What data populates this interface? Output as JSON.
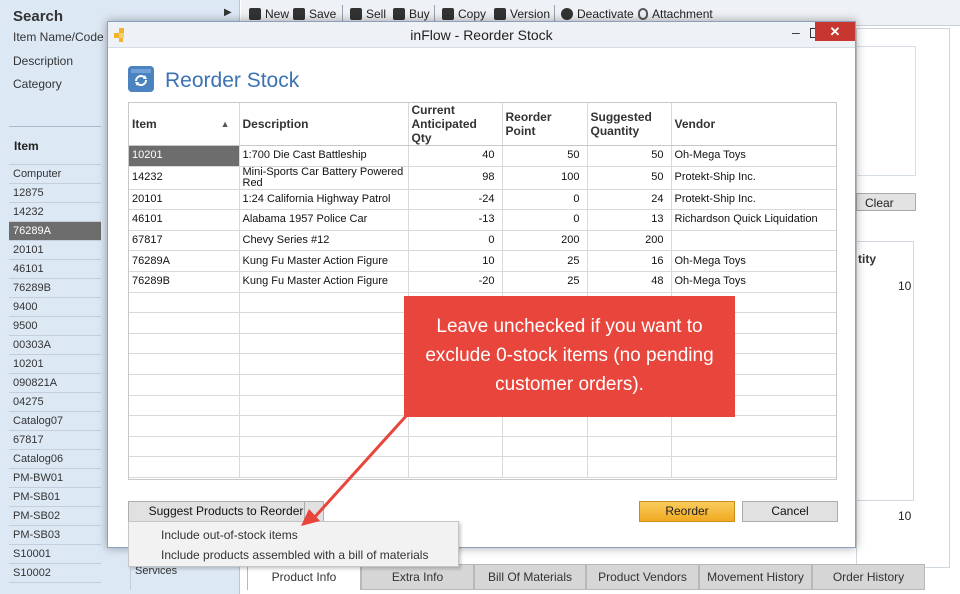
{
  "left_panel": {
    "title": "Search",
    "labels": [
      "Item Name/Code",
      "Description",
      "Category"
    ],
    "list_header": "Item",
    "items": [
      "Computer",
      "12875",
      "14232",
      "76289A",
      "20101",
      "46101",
      "76289B",
      "9400",
      "9500",
      "00303A",
      "10201",
      "090821A",
      "04275",
      "Catalog07",
      "67817",
      "Catalog06",
      "PM-BW01",
      "PM-SB01",
      "PM-SB02",
      "PM-SB03",
      "S10001",
      "S10002"
    ],
    "selected_item": "76289A",
    "services_label": "Services"
  },
  "toolbar": {
    "new": "New",
    "save": "Save",
    "sell": "Sell",
    "buy": "Buy",
    "copy": "Copy",
    "version": "Version",
    "deactivate": "Deactivate",
    "attachment": "Attachment"
  },
  "right_panel": {
    "clear_label": "Clear",
    "header_fragment": "tity",
    "value_top": "10",
    "value_bottom": "10"
  },
  "bottom_tabs": [
    "Product Info",
    "Extra Info",
    "Bill Of Materials",
    "Product Vendors",
    "Movement History",
    "Order History"
  ],
  "modal": {
    "window_title": "inFlow - Reorder Stock",
    "header_title": "Reorder Stock",
    "columns": [
      "Item",
      "Description",
      "Current Anticipated Qty",
      "Reorder Point",
      "Suggested Quantity",
      "Vendor"
    ],
    "rows": [
      {
        "item": "10201",
        "description": "1:700 Die Cast Battleship",
        "qty": "40",
        "reorder": "50",
        "suggested": "50",
        "vendor": "Oh-Mega Toys"
      },
      {
        "item": "14232",
        "description": "Mini-Sports Car Battery Powered Red",
        "qty": "98",
        "reorder": "100",
        "suggested": "50",
        "vendor": "Protekt-Ship Inc."
      },
      {
        "item": "20101",
        "description": "1:24 California Highway Patrol",
        "qty": "-24",
        "reorder": "0",
        "suggested": "24",
        "vendor": "Protekt-Ship Inc."
      },
      {
        "item": "46101",
        "description": "Alabama 1957 Police Car",
        "qty": "-13",
        "reorder": "0",
        "suggested": "13",
        "vendor": "Richardson Quick Liquidation"
      },
      {
        "item": "67817",
        "description": "Chevy Series #12",
        "qty": "0",
        "reorder": "200",
        "suggested": "200",
        "vendor": ""
      },
      {
        "item": "76289A",
        "description": "Kung Fu Master Action Figure",
        "qty": "10",
        "reorder": "25",
        "suggested": "16",
        "vendor": "Oh-Mega Toys"
      },
      {
        "item": "76289B",
        "description": "Kung Fu Master Action Figure",
        "qty": "-20",
        "reorder": "25",
        "suggested": "48",
        "vendor": "Oh-Mega Toys"
      }
    ],
    "suggest_button": "Suggest Products to Reorder",
    "reorder_button": "Reorder",
    "cancel_button": "Cancel",
    "menu_items": [
      "Include out-of-stock items",
      "Include products assembled with a bill of materials"
    ]
  },
  "callout": {
    "text": "Leave unchecked if you want to exclude 0-stock items (no pending customer orders)."
  },
  "colors": {
    "accent_blue": "#3b73b2",
    "callout_red": "#e8453c",
    "reorder_orange": "#f0a921",
    "selected_gray": "#6d6d6d"
  }
}
